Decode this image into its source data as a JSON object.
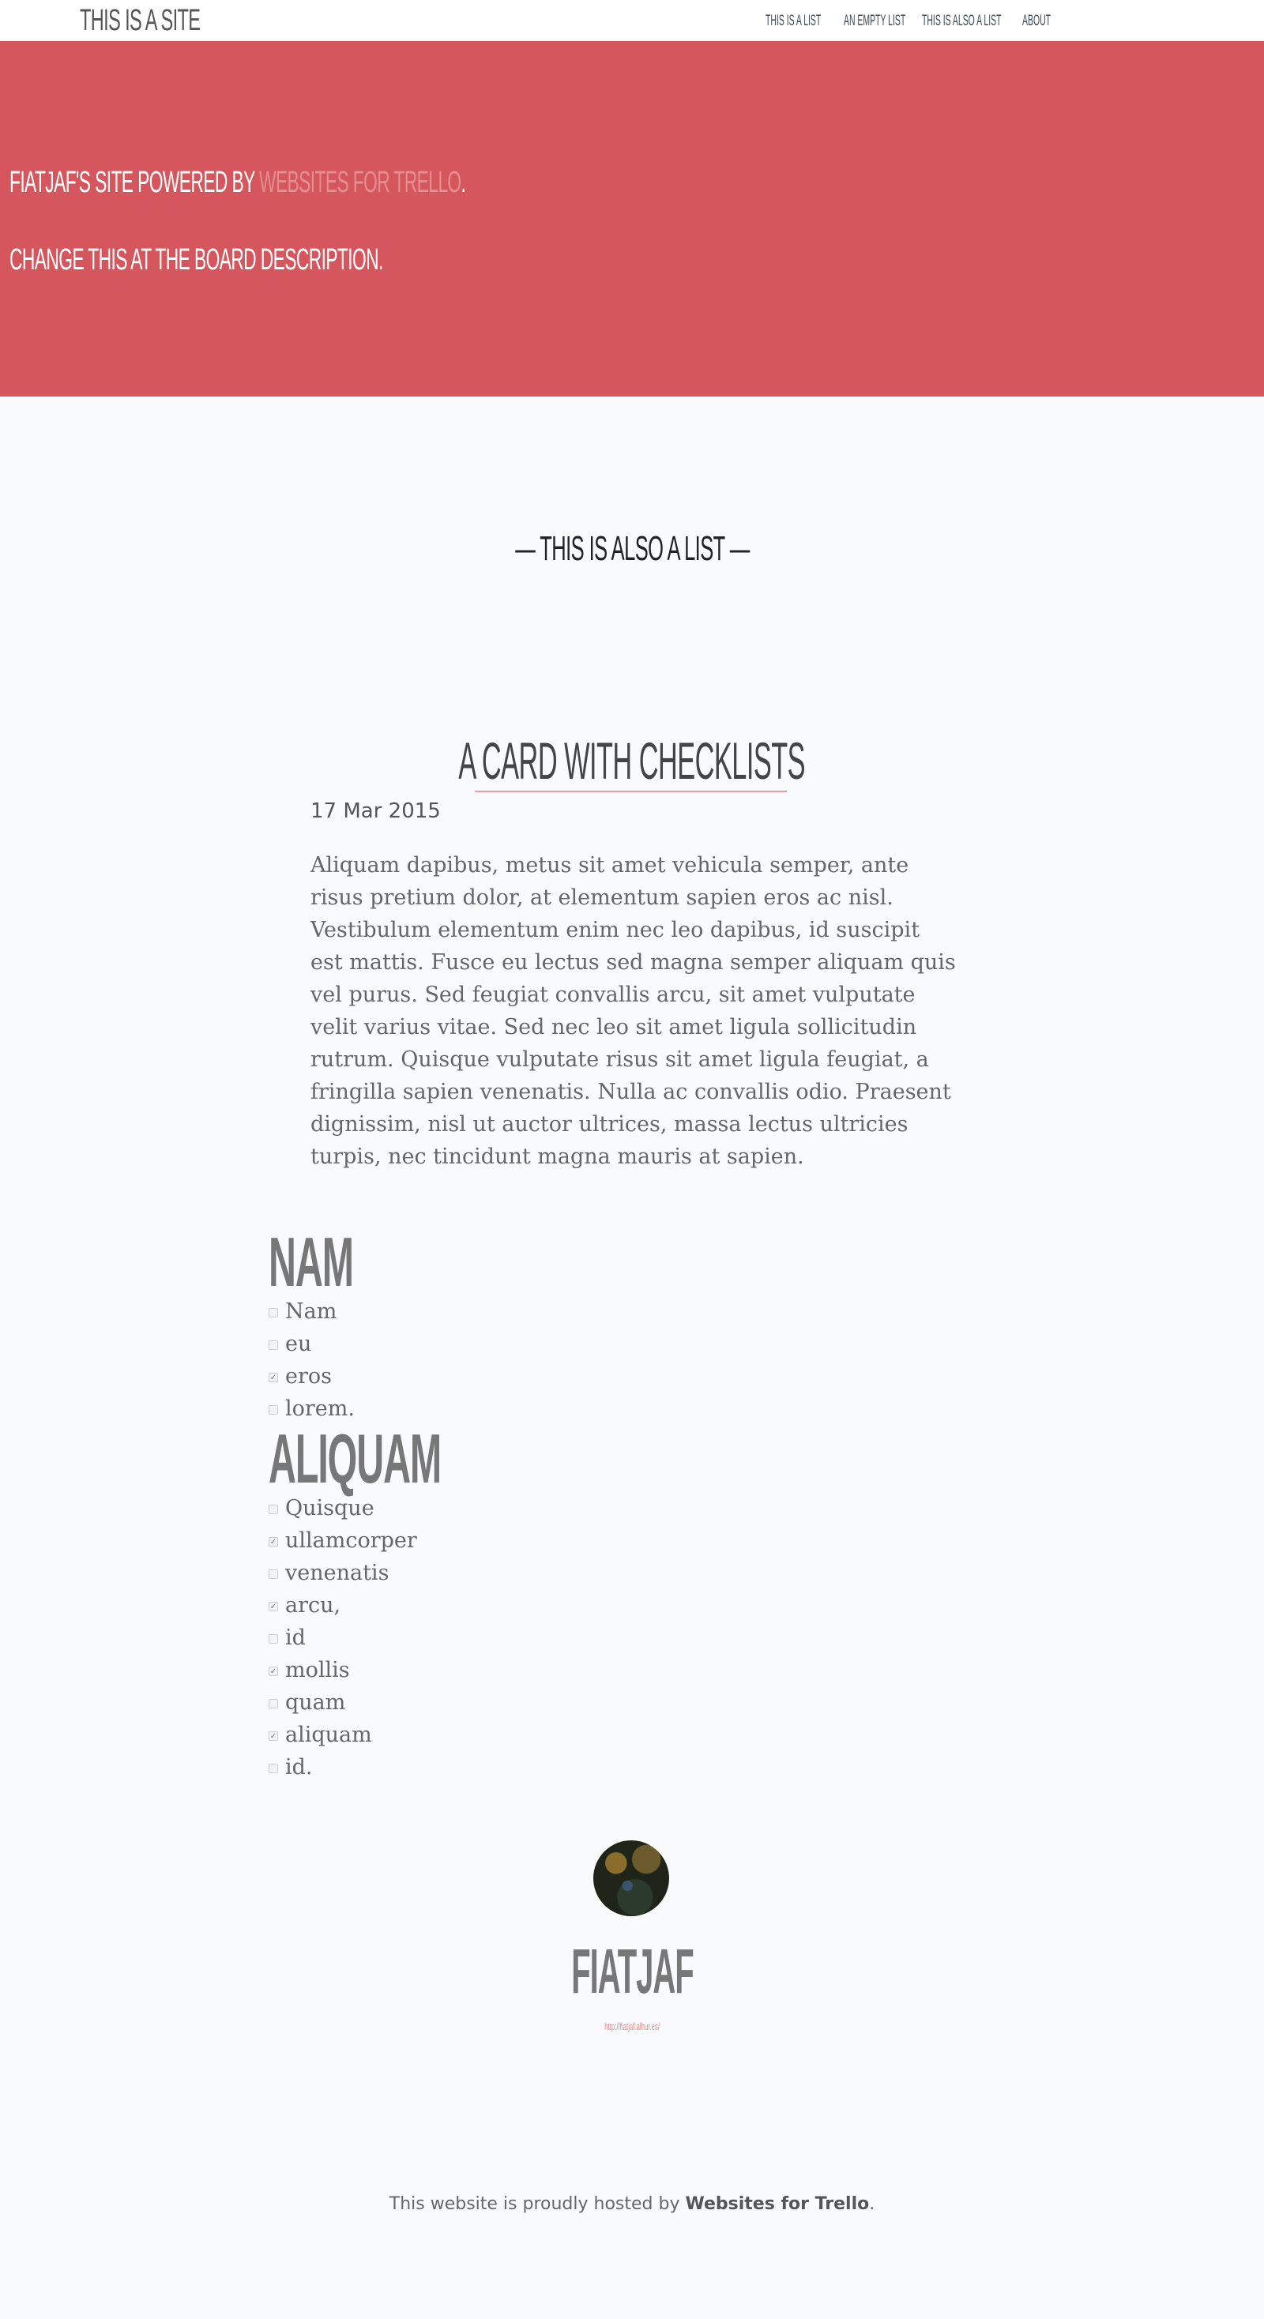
{
  "header": {
    "site_title": "This is a site",
    "nav": [
      {
        "label": "this is a list"
      },
      {
        "label": "an empty list"
      },
      {
        "label": "this is also a list"
      },
      {
        "label": "about"
      }
    ]
  },
  "hero": {
    "line1_prefix": "fiatjaf's site powered by ",
    "line1_link": "Websites for Trello",
    "line1_suffix": ".",
    "line2": "Change this at the board description."
  },
  "list": {
    "heading": "— this is also a list —"
  },
  "card": {
    "title": "a card with checklists",
    "date": "17 Mar 2015",
    "body": "Aliquam dapibus, metus sit amet vehicula semper, ante risus pretium dolor, at elementum sapien eros ac nisl. Vestibulum elementum enim nec leo dapibus, id suscipit est mattis. Fusce eu lectus sed magna semper aliquam quis vel purus. Sed feugiat convallis arcu, sit amet vulputate velit varius vitae. Sed nec leo sit amet ligula sollicitudin rutrum. Quisque vulputate risus sit amet ligula feugiat, a fringilla sapien venenatis. Nulla ac convallis odio. Praesent dignissim, nisl ut auctor ultrices, massa lectus ultricies turpis, nec tincidunt magna mauris at sapien.",
    "checklists": [
      {
        "title": "Nam",
        "items": [
          {
            "label": "Nam",
            "checked": false
          },
          {
            "label": "eu",
            "checked": false
          },
          {
            "label": "eros",
            "checked": true
          },
          {
            "label": "lorem.",
            "checked": false
          }
        ]
      },
      {
        "title": "Aliquam",
        "items": [
          {
            "label": "Quisque",
            "checked": false
          },
          {
            "label": "ullamcorper",
            "checked": true
          },
          {
            "label": "venenatis",
            "checked": false
          },
          {
            "label": "arcu,",
            "checked": true
          },
          {
            "label": "id",
            "checked": false
          },
          {
            "label": "mollis",
            "checked": true
          },
          {
            "label": "quam",
            "checked": false
          },
          {
            "label": "aliquam",
            "checked": true
          },
          {
            "label": "id.",
            "checked": false
          }
        ]
      }
    ]
  },
  "author": {
    "name": "fiatjaf",
    "url": "http://fiatjaf.alhur.es/"
  },
  "footer": {
    "prefix": "This website is proudly hosted by ",
    "brand": "Websites for Trello",
    "suffix": "."
  },
  "colors": {
    "hero_bg": "#d5575d",
    "page_bg": "#f9fafc",
    "accent_link": "#e58a8d"
  }
}
